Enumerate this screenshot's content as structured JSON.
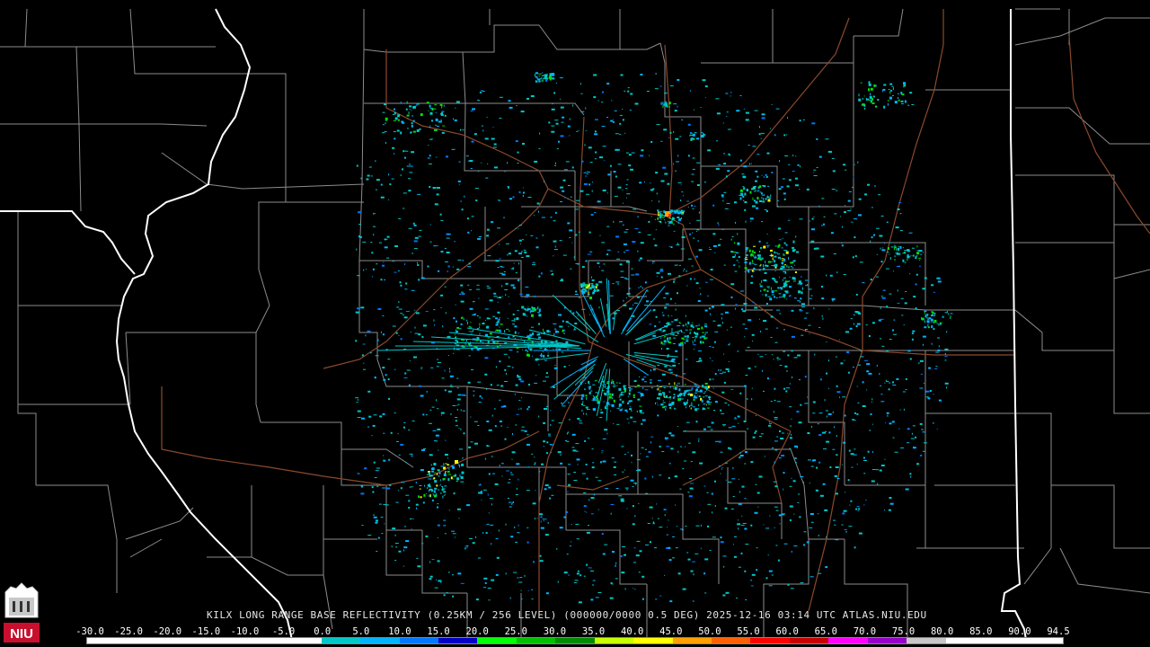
{
  "title": "KILX LONG RANGE BASE REFLECTIVITY (0.25KM / 256 LEVEL) (000000/0000 0.5 DEG) 2025-12-16 03:14 UTC  ATLAS.NIU.EDU",
  "logo_text": "NIU",
  "colorbar": {
    "labels": [
      "-30.0",
      "-25.0",
      "-20.0",
      "-15.0",
      "-10.0",
      "-5.0",
      "0.0",
      "5.0",
      "10.0",
      "15.0",
      "20.0",
      "25.0",
      "30.0",
      "35.0",
      "40.0",
      "45.0",
      "50.0",
      "55.0",
      "60.0",
      "65.0",
      "70.0",
      "75.0",
      "80.0",
      "85.0",
      "90.0",
      "94.5"
    ],
    "colors": [
      "#ffffff",
      "#ffffff",
      "#ffffff",
      "#ffffff",
      "#ffffff",
      "#ffffff",
      "#00c8c8",
      "#00b4ff",
      "#0078ff",
      "#0000c8",
      "#00ff00",
      "#00c000",
      "#008c00",
      "#c8ff00",
      "#ffff00",
      "#ffa000",
      "#ff6000",
      "#ff0000",
      "#c80000",
      "#ff00ff",
      "#9600c8",
      "#c8c8c8",
      "#ffffff",
      "#ffffff",
      "#ffffff"
    ]
  },
  "colors": {
    "background": "#000000",
    "county_lines": "#8c8c8c",
    "state_lines": "#ffffff",
    "highways": "#8b4a2c",
    "echo_light": "#00c8c8",
    "echo_mid": "#00b4ff",
    "echo_blue": "#0078ff",
    "echo_green": "#00e000",
    "echo_yellow": "#ffff00",
    "echo_orange": "#ffa000",
    "echo_red": "#ff3000"
  }
}
